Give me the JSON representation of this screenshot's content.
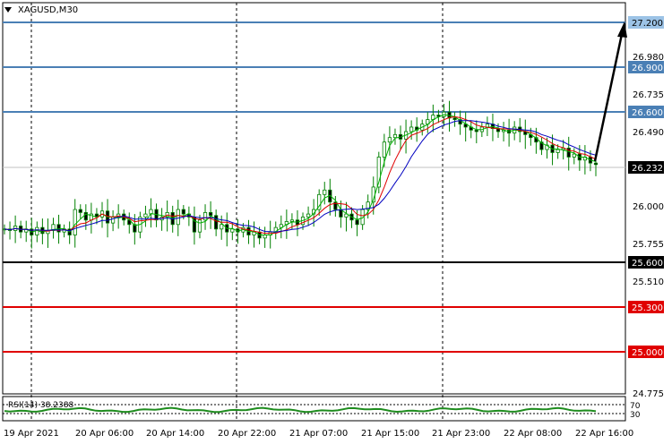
{
  "symbol_label": "XAGUSD,M30",
  "rsi_label": "RSI(14) 38.2388",
  "rsi_levels": [
    "70",
    "30"
  ],
  "price_axis_ticks": [
    "26.980",
    "26.735",
    "26.490",
    "26.000",
    "25.755",
    "25.510",
    "24.775"
  ],
  "horizontal_levels": [
    {
      "label": "27.200",
      "value": 27.2,
      "color": "#4a7fb5",
      "style": "box-light"
    },
    {
      "label": "26.900",
      "value": 26.9,
      "color": "#4a7fb5",
      "style": "box-blue"
    },
    {
      "label": "26.600",
      "value": 26.6,
      "color": "#4a7fb5",
      "style": "box-blue"
    },
    {
      "label": "26.232",
      "value": 26.232,
      "color": "#c0c0c0",
      "style": "box-black"
    },
    {
      "label": "25.600",
      "value": 25.6,
      "color": "#000000",
      "style": "box-black"
    },
    {
      "label": "25.300",
      "value": 25.3,
      "color": "#e00000",
      "style": "box-red"
    },
    {
      "label": "25.000",
      "value": 25.0,
      "color": "#e00000",
      "style": "box-red"
    }
  ],
  "time_axis_labels": [
    "19 Apr 2021",
    "20 Apr 06:00",
    "20 Apr 14:00",
    "20 Apr 22:00",
    "21 Apr 07:00",
    "21 Apr 15:00",
    "21 Apr 23:00",
    "22 Apr 08:00",
    "22 Apr 16:00"
  ],
  "colors": {
    "candles": "#008000",
    "ma_fast": "#00b000",
    "ma_mid": "#e00000",
    "ma_slow": "#0000c0",
    "rsi": "#1e8c1e"
  },
  "chart_data": {
    "type": "candlestick",
    "ylim": [
      24.72,
      27.33
    ],
    "close_series": [
      25.82,
      25.81,
      25.84,
      25.8,
      25.82,
      25.78,
      25.83,
      25.79,
      25.81,
      25.85,
      25.8,
      25.82,
      25.78,
      25.95,
      25.93,
      25.88,
      25.92,
      25.9,
      25.94,
      25.86,
      25.9,
      25.92,
      25.88,
      25.85,
      25.8,
      25.9,
      25.92,
      25.95,
      25.88,
      25.9,
      25.93,
      25.85,
      25.95,
      25.92,
      25.9,
      25.8,
      25.88,
      25.93,
      25.91,
      25.82,
      25.85,
      25.8,
      25.82,
      25.8,
      25.83,
      25.78,
      25.8,
      25.76,
      25.78,
      25.8,
      25.83,
      25.85,
      25.87,
      25.88,
      25.85,
      25.9,
      25.92,
      25.95,
      26.05,
      26.08,
      26.0,
      25.95,
      25.9,
      25.92,
      25.88,
      25.85,
      25.95,
      26.0,
      26.1,
      26.3,
      26.4,
      26.43,
      26.45,
      26.42,
      26.47,
      26.5,
      26.48,
      26.52,
      26.55,
      26.58,
      26.57,
      26.6,
      26.56,
      26.55,
      26.52,
      26.5,
      26.48,
      26.47,
      26.5,
      26.52,
      26.49,
      26.47,
      26.48,
      26.46,
      26.5,
      26.47,
      26.45,
      26.43,
      26.4,
      26.35,
      26.38,
      26.33,
      26.35,
      26.36,
      26.3,
      26.32,
      26.28,
      26.3,
      26.26,
      26.25
    ],
    "rsi_value": 38.2388,
    "forecast_target": 27.2
  }
}
